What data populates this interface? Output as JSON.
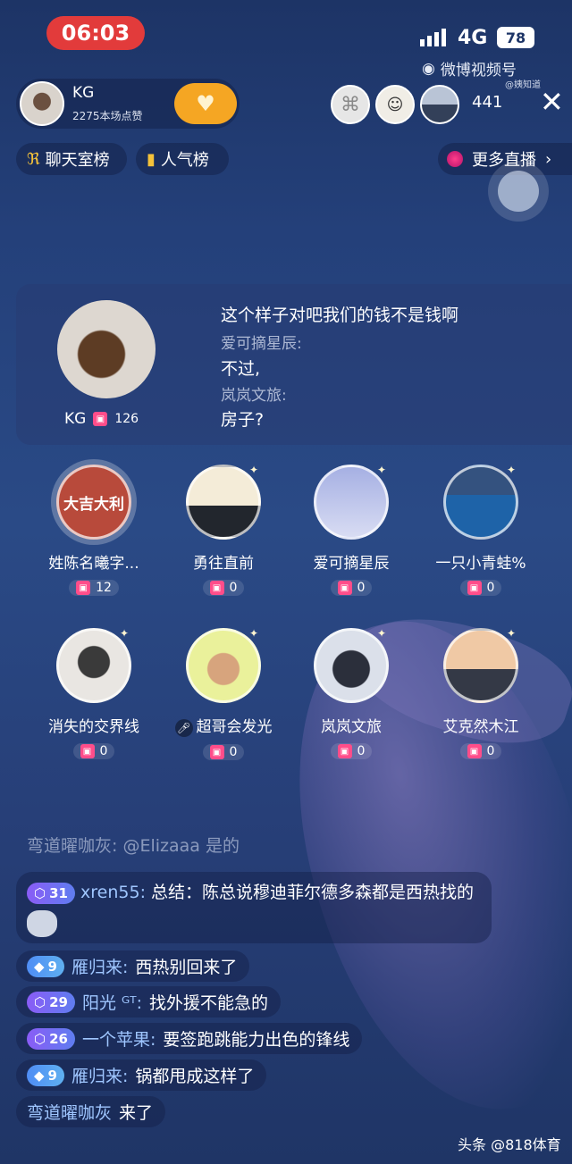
{
  "status": {
    "time": "06:03",
    "network": "4G",
    "battery": "78"
  },
  "brand": {
    "name": "微博视频号",
    "sub": "@姨知道"
  },
  "host": {
    "name": "KG",
    "likes": "2275本场点赞"
  },
  "viewers": {
    "count": "441"
  },
  "chips": {
    "chat_rank": "聊天室榜",
    "popularity_rank": "人气榜",
    "more_live": "更多直播"
  },
  "host_panel": {
    "name": "KG",
    "gift_count": "126",
    "messages": [
      {
        "text": "这个样子对吧我们的钱不是钱啊"
      },
      {
        "sub": "爱可摘星辰:"
      },
      {
        "text": "不过,"
      },
      {
        "sub": "岚岚文旅:"
      },
      {
        "text": "房子?"
      }
    ]
  },
  "seats": [
    {
      "name": "姓陈名曦字...",
      "gifts": "12",
      "avatar_text": "大吉大利"
    },
    {
      "name": "勇往直前",
      "gifts": "0"
    },
    {
      "name": "爱可摘星辰",
      "gifts": "0"
    },
    {
      "name": "一只小青蛙%",
      "gifts": "0"
    },
    {
      "name": "消失的交界线",
      "gifts": "0"
    },
    {
      "name": "超哥会发光",
      "gifts": "0"
    },
    {
      "name": "岚岚文旅",
      "gifts": "0"
    },
    {
      "name": "艾克然木江",
      "gifts": "0"
    }
  ],
  "chat": {
    "faded": "弯道曜咖灰: @Elizaaa 是的",
    "multi": {
      "level": "31",
      "user": "xren55:",
      "text": "总结：陈总说穆迪菲尔德多森都是西热找的"
    },
    "lines": [
      {
        "level": "9",
        "user": "雁归来:",
        "text": "西热别回来了"
      },
      {
        "level": "29",
        "user": "阳光 ᴳᵀ:",
        "text": "找外援不能急的"
      },
      {
        "level": "26",
        "user": "一个苹果:",
        "text": "要签跑跳能力出色的锋线"
      },
      {
        "level": "9",
        "user": "雁归来:",
        "text": "锅都甩成这样了"
      }
    ],
    "join": {
      "user": "弯道曜咖灰",
      "text": "来了"
    }
  },
  "watermark": "头条 @818体育"
}
